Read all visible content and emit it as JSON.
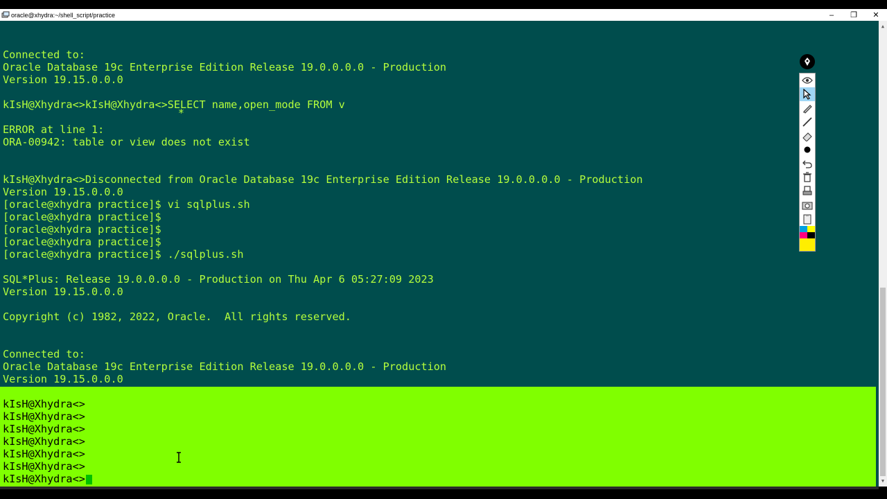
{
  "window": {
    "title": "oracle@xhydra:~/shell_script/practice",
    "minimize_glyph": "–",
    "maximize_glyph": "❐",
    "close_glyph": "✕"
  },
  "terminal": {
    "lines": [
      "Connected to:",
      "Oracle Database 19c Enterprise Edition Release 19.0.0.0.0 - Production",
      "Version 19.15.0.0.0",
      "",
      "kIsH@Xhydra<>kIsH@Xhydra<>SELECT name,open_mode FROM v",
      "                            *",
      "ERROR at line 1:",
      "ORA-00942: table or view does not exist",
      "",
      "",
      "kIsH@Xhydra<>Disconnected from Oracle Database 19c Enterprise Edition Release 19.0.0.0.0 - Production",
      "Version 19.15.0.0.0",
      "[oracle@xhydra practice]$ vi sqlplus.sh",
      "[oracle@xhydra practice]$",
      "[oracle@xhydra practice]$",
      "[oracle@xhydra practice]$",
      "[oracle@xhydra practice]$ ./sqlplus.sh",
      "",
      "SQL*Plus: Release 19.0.0.0.0 - Production on Thu Apr 6 05:27:09 2023",
      "Version 19.15.0.0.0",
      "",
      "Copyright (c) 1982, 2022, Oracle.  All rights reserved.",
      "",
      "",
      "Connected to:",
      "Oracle Database 19c Enterprise Edition Release 19.0.0.0.0 - Production",
      "Version 19.15.0.0.0"
    ],
    "highlighted_lines": [
      "kIsH@Xhydra<>",
      "kIsH@Xhydra<>",
      "kIsH@Xhydra<>",
      "kIsH@Xhydra<>",
      "kIsH@Xhydra<>",
      "kIsH@Xhydra<>",
      "kIsH@Xhydra<>"
    ]
  },
  "colors": {
    "terminal_bg": "#004d4d",
    "terminal_fg": "#b5ff3c",
    "highlight_bg": "#80ff00",
    "cursor": "#00c000"
  },
  "toolbox": {
    "tools": [
      "eye-icon",
      "pointer-icon",
      "pen-icon",
      "line-icon",
      "eraser-icon",
      "dot-icon",
      "undo-icon",
      "trash-icon",
      "stamp-icon",
      "camera-icon",
      "clipboard-icon"
    ],
    "active_tool": "pointer-icon",
    "palette": [
      "#00a0e0",
      "#ffff00",
      "#ff0080",
      "#000000",
      "#ffee00",
      "#ffee00"
    ]
  }
}
